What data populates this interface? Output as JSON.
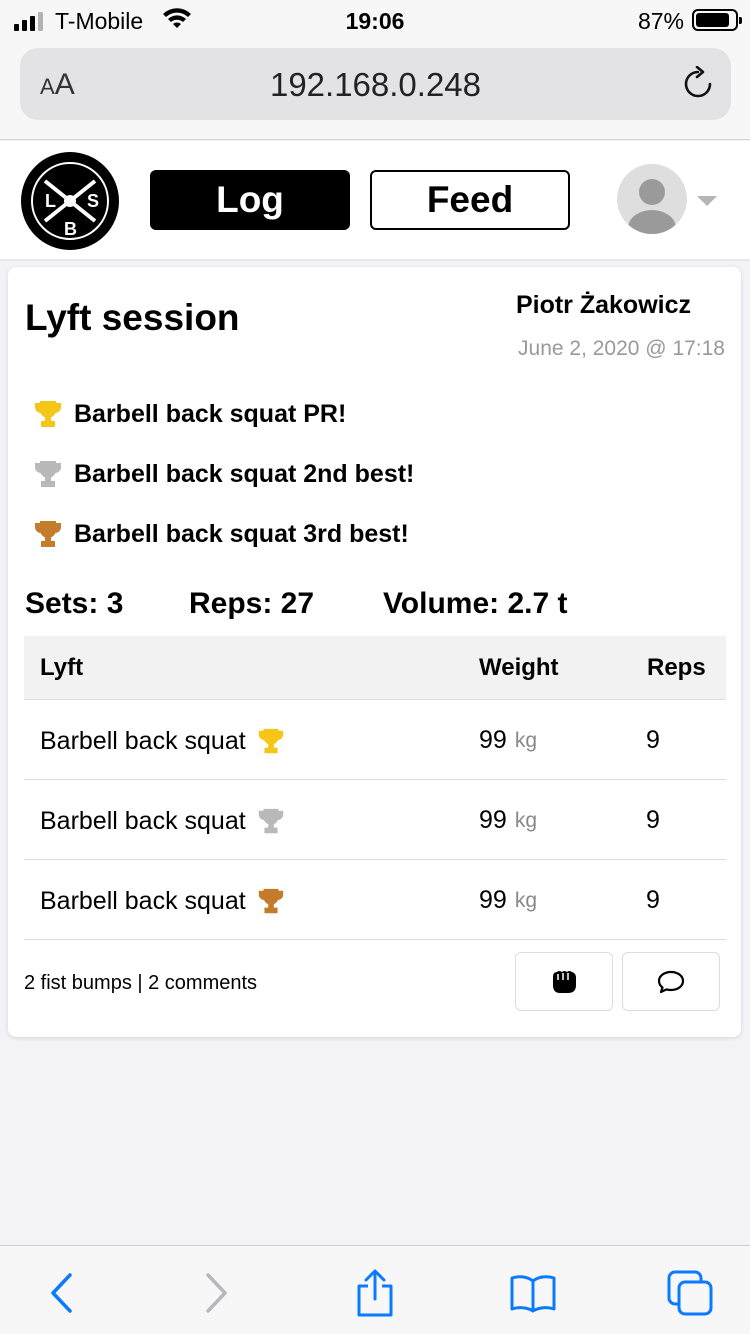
{
  "status_bar": {
    "carrier": "T-Mobile",
    "time": "19:06",
    "battery_percent": "87%",
    "battery_level": 0.87,
    "signal_bars": 3,
    "signal_bars_total": 4
  },
  "browser": {
    "text_size_label": "AA",
    "url": "192.168.0.248",
    "icons": [
      "text-size-icon",
      "reload-icon",
      "back-icon",
      "forward-icon",
      "share-icon",
      "bookmarks-icon",
      "tabs-icon"
    ]
  },
  "header": {
    "logo_letters": [
      "L",
      "S",
      "B"
    ],
    "nav": [
      {
        "label": "Log",
        "active": true
      },
      {
        "label": "Feed",
        "active": false
      }
    ],
    "avatar_icon": "user-avatar-icon"
  },
  "session": {
    "title": "Lyft session",
    "author": "Piotr Żakowicz",
    "date": "June 2, 2020 @ 17:18",
    "achievements": [
      {
        "text": "Barbell back squat PR!",
        "medal": "gold"
      },
      {
        "text": "Barbell back squat 2nd best!",
        "medal": "silver"
      },
      {
        "text": "Barbell back squat 3rd best!",
        "medal": "bronze"
      }
    ],
    "stats": {
      "sets": "Sets: 3",
      "reps": "Reps: 27",
      "volume": "Volume: 2.7 t"
    },
    "table": {
      "headers": [
        "Lyft",
        "Weight",
        "Reps"
      ],
      "rows": [
        {
          "lyft": "Barbell back squat",
          "weight": "99",
          "unit": "kg",
          "reps": "9",
          "medal": "gold"
        },
        {
          "lyft": "Barbell back squat",
          "weight": "99",
          "unit": "kg",
          "reps": "9",
          "medal": "silver"
        },
        {
          "lyft": "Barbell back squat",
          "weight": "99",
          "unit": "kg",
          "reps": "9",
          "medal": "bronze"
        }
      ]
    },
    "footer": {
      "summary": "2 fist bumps | 2 comments",
      "actions": [
        "fist-bump-icon",
        "comment-icon"
      ]
    }
  },
  "colors": {
    "gold": "#f5c518",
    "silver": "#b9b9b9",
    "bronze": "#c47b2b",
    "ios_blue": "#0a7aff"
  }
}
